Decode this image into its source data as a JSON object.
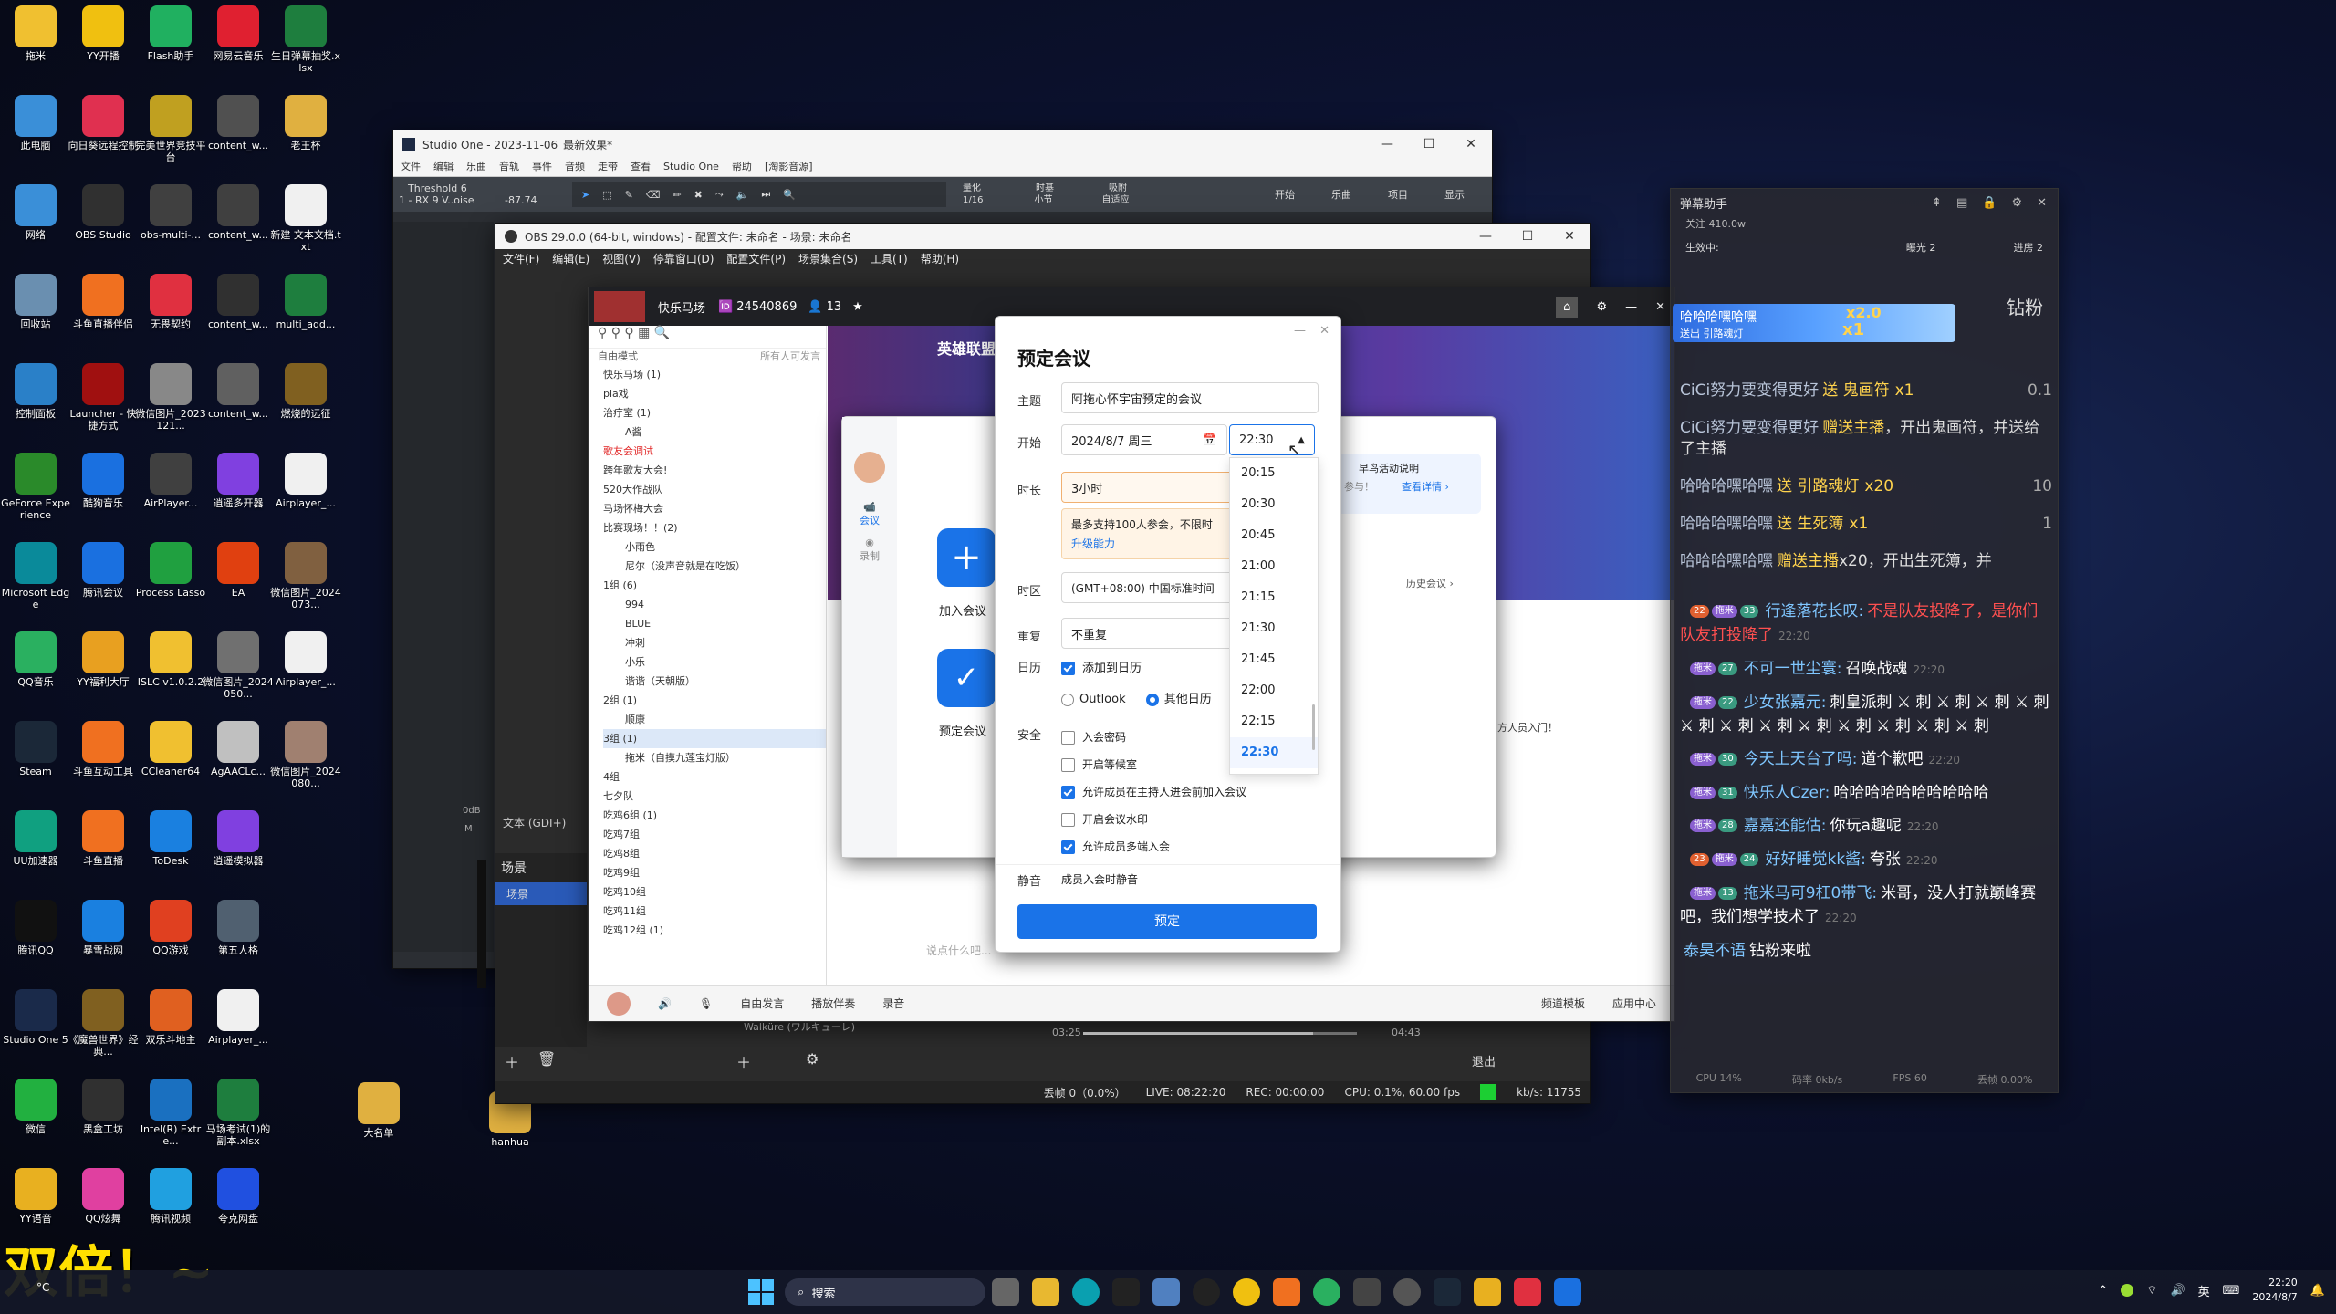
{
  "desktop_icons": [
    {
      "label": "拖米",
      "color": "#f0c030"
    },
    {
      "label": "此电脑",
      "color": "#3a8fd8"
    },
    {
      "label": "网络",
      "color": "#3a8fd8"
    },
    {
      "label": "回收站",
      "color": "#6a8fb0"
    },
    {
      "label": "控制面板",
      "color": "#2a80c8"
    },
    {
      "label": "GeForce Experience",
      "color": "#2a8a2a"
    },
    {
      "label": "Microsoft Edge",
      "color": "#0a8a9a"
    },
    {
      "label": "QQ音乐",
      "color": "#2ab060"
    },
    {
      "label": "Steam",
      "color": "#1b2838"
    },
    {
      "label": "UU加速器",
      "color": "#10a080"
    },
    {
      "label": "腾讯QQ",
      "color": "#111111"
    },
    {
      "label": "Studio One 5",
      "color": "#1a2a4a"
    },
    {
      "label": "微信",
      "color": "#22b040"
    },
    {
      "label": "YY语音",
      "color": "#e8b020"
    },
    {
      "label": "YY开播",
      "color": "#f0c010"
    },
    {
      "label": "向日葵远程控制",
      "color": "#e03050"
    },
    {
      "label": "OBS Studio",
      "color": "#303030"
    },
    {
      "label": "斗鱼直播伴侣",
      "color": "#f07020"
    },
    {
      "label": "Launcher - 快捷方式",
      "color": "#a01010"
    },
    {
      "label": "酷狗音乐",
      "color": "#1a70e0"
    },
    {
      "label": "腾讯会议",
      "color": "#1a70e0"
    },
    {
      "label": "YY福利大厅",
      "color": "#e8a020"
    },
    {
      "label": "斗鱼互动工具",
      "color": "#f07020"
    },
    {
      "label": "斗鱼直播",
      "color": "#f07020"
    },
    {
      "label": "暴雪战网",
      "color": "#1a80e0"
    },
    {
      "label": "《魔兽世界》经典...",
      "color": "#806020"
    },
    {
      "label": "黑盒工坊",
      "color": "#303030"
    },
    {
      "label": "QQ炫舞",
      "color": "#e040a0"
    },
    {
      "label": "Flash助手",
      "color": "#20b060"
    },
    {
      "label": "完美世界竞技平台",
      "color": "#c0a020"
    },
    {
      "label": "obs-multi-...",
      "color": "#404040"
    },
    {
      "label": "无畏契约",
      "color": "#e03040"
    },
    {
      "label": "微信图片_2023121...",
      "color": "#888888"
    },
    {
      "label": "AirPlayer...",
      "color": "#404040"
    },
    {
      "label": "Process Lasso",
      "color": "#20a040"
    },
    {
      "label": "ISLC v1.0.2.2",
      "color": "#f0c030"
    },
    {
      "label": "CCleaner64",
      "color": "#f0c030"
    },
    {
      "label": "ToDesk",
      "color": "#1a80e0"
    },
    {
      "label": "QQ游戏",
      "color": "#e04020"
    },
    {
      "label": "双乐斗地主",
      "color": "#e06020"
    },
    {
      "label": "Intel(R) Extre...",
      "color": "#1a70c0"
    },
    {
      "label": "腾讯视频",
      "color": "#20a0e0"
    },
    {
      "label": "网易云音乐",
      "color": "#e02030"
    },
    {
      "label": "content_w...",
      "color": "#505050"
    },
    {
      "label": "content_w...",
      "color": "#404040"
    },
    {
      "label": "content_w...",
      "color": "#303030"
    },
    {
      "label": "content_w...",
      "color": "#606060"
    },
    {
      "label": "逍遥多开器",
      "color": "#8040e0"
    },
    {
      "label": "EA",
      "color": "#e04010"
    },
    {
      "label": "微信图片_2024050...",
      "color": "#707070"
    },
    {
      "label": "AgAACLc...",
      "color": "#c0c0c0"
    },
    {
      "label": "逍遥模拟器",
      "color": "#8040e0"
    },
    {
      "label": "第五人格",
      "color": "#506070"
    },
    {
      "label": "Airplayer_...",
      "color": "#f0f0f0"
    },
    {
      "label": "马场考试(1)的副本.xlsx",
      "color": "#1e7e3e"
    },
    {
      "label": "夸克网盘",
      "color": "#2050e0"
    },
    {
      "label": "生日弹幕抽奖.xlsx",
      "color": "#1e7e3e"
    },
    {
      "label": "老王杯",
      "color": "#e0b040"
    },
    {
      "label": "新建 文本文档.txt",
      "color": "#f0f0f0"
    },
    {
      "label": "multi_add...",
      "color": "#1e7e3e"
    },
    {
      "label": "燃烧的远征",
      "color": "#806020"
    },
    {
      "label": "Airplayer_...",
      "color": "#f0f0f0"
    },
    {
      "label": "微信图片_2024073...",
      "color": "#806040"
    },
    {
      "label": "Airplayer_...",
      "color": "#f0f0f0"
    },
    {
      "label": "微信图片_2024080...",
      "color": "#a08070"
    },
    {
      "label": "大名单",
      "color": "#e0b040"
    },
    {
      "label": "hanhua",
      "color": "#e0b040"
    }
  ],
  "studio_one": {
    "title": "Studio One - 2023-11-06_最新效果*",
    "menu": [
      "文件",
      "编辑",
      "乐曲",
      "音轨",
      "事件",
      "音频",
      "走带",
      "查看",
      "Studio One",
      "帮助",
      "[淘影音源]"
    ],
    "preset_name": "Threshold 6",
    "preset_sub": "1 - RX 9 V..oise",
    "level": "-87.74",
    "toolbar_labels": [
      "开始",
      "乐曲",
      "项目",
      "显示"
    ],
    "quantize": "1/16",
    "timebase": "小节",
    "snap": "自适应",
    "tabs": [
      "量化",
      "时基",
      "吸附"
    ],
    "db": "0dB",
    "m": "M"
  },
  "obs": {
    "title": "OBS 29.0.0 (64-bit, windows) - 配置文件: 未命名 - 场景: 未命名",
    "menu": [
      "文件(F)",
      "编辑(E)",
      "视图(V)",
      "停靠窗口(D)",
      "配置文件(P)",
      "场景集合(S)",
      "工具(T)",
      "帮助(H)"
    ],
    "scenes_header": "场景",
    "scene_item": "场景",
    "source_text": "文本 (GDI+)",
    "status": {
      "dropped": "丢帧 0（0.0%）",
      "live": "LIVE: 08:22:20",
      "rec": "REC: 00:00:00",
      "cpu": "CPU: 0.1%, 60.00 fps",
      "kbs": "kb/s: 11755"
    },
    "exit_label": "退出",
    "song": "Walküre (ワルキューレ)",
    "time_start": "03:25",
    "time_end": "04:43"
  },
  "yy": {
    "channel": "快乐马场",
    "channel_id": "24540869",
    "online": "13",
    "mode": "自由模式",
    "mode_right": "所有人可发言",
    "tree": [
      "快乐马场 (1)",
      "pia戏",
      "治疗室 (1)",
      "A酱",
      "歌友会调试",
      "跨年歌友大会!",
      "520大作战队",
      "马场怀梅大会",
      "比赛现场！！(2)",
      "小雨色",
      "尼尔（没声音就是在吃饭）",
      "1组 (6)",
      "994",
      "BLUE",
      "冲刺",
      "小乐",
      "谐谐（天朝版）",
      "2组 (1)",
      "顺康",
      "3组 (1)",
      "拖米（自摸九莲宝灯版）",
      "4组",
      "七夕队",
      "吃鸡6组 (1)",
      "吃鸡7组",
      "吃鸡8组",
      "吃鸡9组",
      "吃鸡10组",
      "吃鸡11组",
      "吃鸡12组 (1)"
    ],
    "bottom": [
      "自由发言",
      "播放伴奏",
      "录音",
      "频道模板",
      "应用中心"
    ],
    "chat_placeholder": "说点什么吧...",
    "game_banner": "英雄联盟",
    "join_label": "加入会议",
    "schedule_label": "预定会议",
    "side_meet": "会议",
    "side_rec": "录制",
    "history_link": "历史会议 ›",
    "activity": "早鸟活动说明",
    "activity_sub": "参与！",
    "detail_link": "查看详情 ›",
    "notice": "方人员入门！"
  },
  "meeting": {
    "title": "预定会议",
    "labels": {
      "subject": "主题",
      "start": "开始",
      "duration": "时长",
      "timezone": "时区",
      "repeat": "重复",
      "calendar": "日历",
      "security": "安全",
      "mute": "静音"
    },
    "subject": "阿拖心怀宇宙预定的会议",
    "date": "2024/8/7 周三",
    "time": "22:30",
    "duration": "3小时",
    "tip": "最多支持100人参会，不限时",
    "tip_link": "升级能力",
    "timezone": "(GMT+08:00) 中国标准时间",
    "repeat": "不重复",
    "add_calendar": "添加到日历",
    "outlook": "Outlook",
    "other_cal": "其他日历",
    "sec_options": [
      {
        "label": "入会密码",
        "on": false
      },
      {
        "label": "开启等候室",
        "on": false
      },
      {
        "label": "允许成员在主持人进会前加入会议",
        "on": true
      },
      {
        "label": "开启会议水印",
        "on": false
      },
      {
        "label": "允许成员多端入会",
        "on": true
      }
    ],
    "mute_value": "成员入会时静音",
    "submit": "预定",
    "time_options": [
      "20:15",
      "20:30",
      "20:45",
      "21:00",
      "21:15",
      "21:30",
      "21:45",
      "22:00",
      "22:15",
      "22:30"
    ],
    "selected_time": "22:30"
  },
  "danmu": {
    "title": "弹幕助手",
    "followers": "关注 410.0w",
    "stats": [
      "生效中:",
      "曝光 2",
      "进房 2"
    ],
    "gift_banner": "哈哈哈嘿哈嘿",
    "gift_banner_sub": "送出 引路魂灯",
    "gift_count": "x2.0",
    "gift_x": "x1",
    "gift_side": "钻粉",
    "lines": [
      {
        "user": "CiCi努力要变得更好",
        "text": "送 鬼画符",
        "count": "x1",
        "right": "0.1"
      },
      {
        "user": "CiCi努力要变得更好",
        "text": "赠送主播",
        "extra": "，开出鬼画符，并送给了主播"
      },
      {
        "user": "哈哈哈嘿哈嘿",
        "text": "送 引路魂灯",
        "count": "x20",
        "right": "10"
      },
      {
        "user": "哈哈哈嘿哈嘿",
        "text": "送 生死簿",
        "count": "x1",
        "right": "1"
      },
      {
        "user": "哈哈哈嘿哈嘿",
        "text": "赠送主播",
        "extra": "x20，开出生死簿，并"
      }
    ],
    "chats": [
      {
        "lv": "22",
        "tag": "拖米",
        "fan": "33",
        "user": "行逢落花长叹:",
        "msg": "不是队友投降了，是你们队友打投降了",
        "t": "22:20"
      },
      {
        "lv": "",
        "tag": "拖米",
        "fan": "27",
        "user": "不可一世尘寰:",
        "msg": "召唤战魂",
        "t": "22:20"
      },
      {
        "lv": "",
        "tag": "拖米",
        "fan": "22",
        "user": "少女张嘉元:",
        "msg": "刺皇派刺 ⚔ 刺 ⚔ 刺 ⚔ 刺 ⚔ 刺 ⚔ 刺 ⚔ 刺 ⚔ 刺 ⚔ 刺 ⚔ 刺 ⚔ 刺 ⚔ 刺 ⚔ 刺",
        "t": ""
      },
      {
        "lv": "",
        "tag": "拖米",
        "fan": "30",
        "user": "今天上天台了吗:",
        "msg": "道个歉吧",
        "t": "22:20"
      },
      {
        "lv": "",
        "tag": "拖米",
        "fan": "31",
        "user": "快乐人Czer:",
        "msg": "哈哈哈哈哈哈哈哈哈哈",
        "t": ""
      },
      {
        "lv": "",
        "tag": "拖米",
        "fan": "28",
        "user": "嘉嘉还能估:",
        "msg": "你玩a趣呢",
        "t": "22:20"
      },
      {
        "lv": "23",
        "tag": "拖米",
        "fan": "24",
        "user": "好好睡觉kk酱:",
        "msg": "夸张",
        "t": "22:20"
      },
      {
        "lv": "",
        "tag": "拖米",
        "fan": "13",
        "user": "拖米马可9杠0带飞:",
        "msg": "米哥，没人打就巅峰赛吧，我们想学技术了",
        "t": "22:20"
      },
      {
        "lv": "",
        "tag": "",
        "fan": "",
        "user": "泰昊不语",
        "msg": "钻粉来啦",
        "t": ""
      }
    ],
    "footer": [
      "CPU 14%",
      "码率 0kb/s",
      "FPS 60",
      "丢帧 0.00%"
    ]
  },
  "overlay_text": "双倍！~",
  "taskbar": {
    "search": "搜索",
    "time": "22:20",
    "date": "2024/8/7",
    "ime": "英",
    "weather": "°C"
  },
  "colors": {
    "accent": "#1a73e8",
    "danmu_user": "#7fc6ff",
    "danmu_gift": "#ffd34d",
    "danmu_red": "#ff5050",
    "overlay": "#ffe000"
  }
}
